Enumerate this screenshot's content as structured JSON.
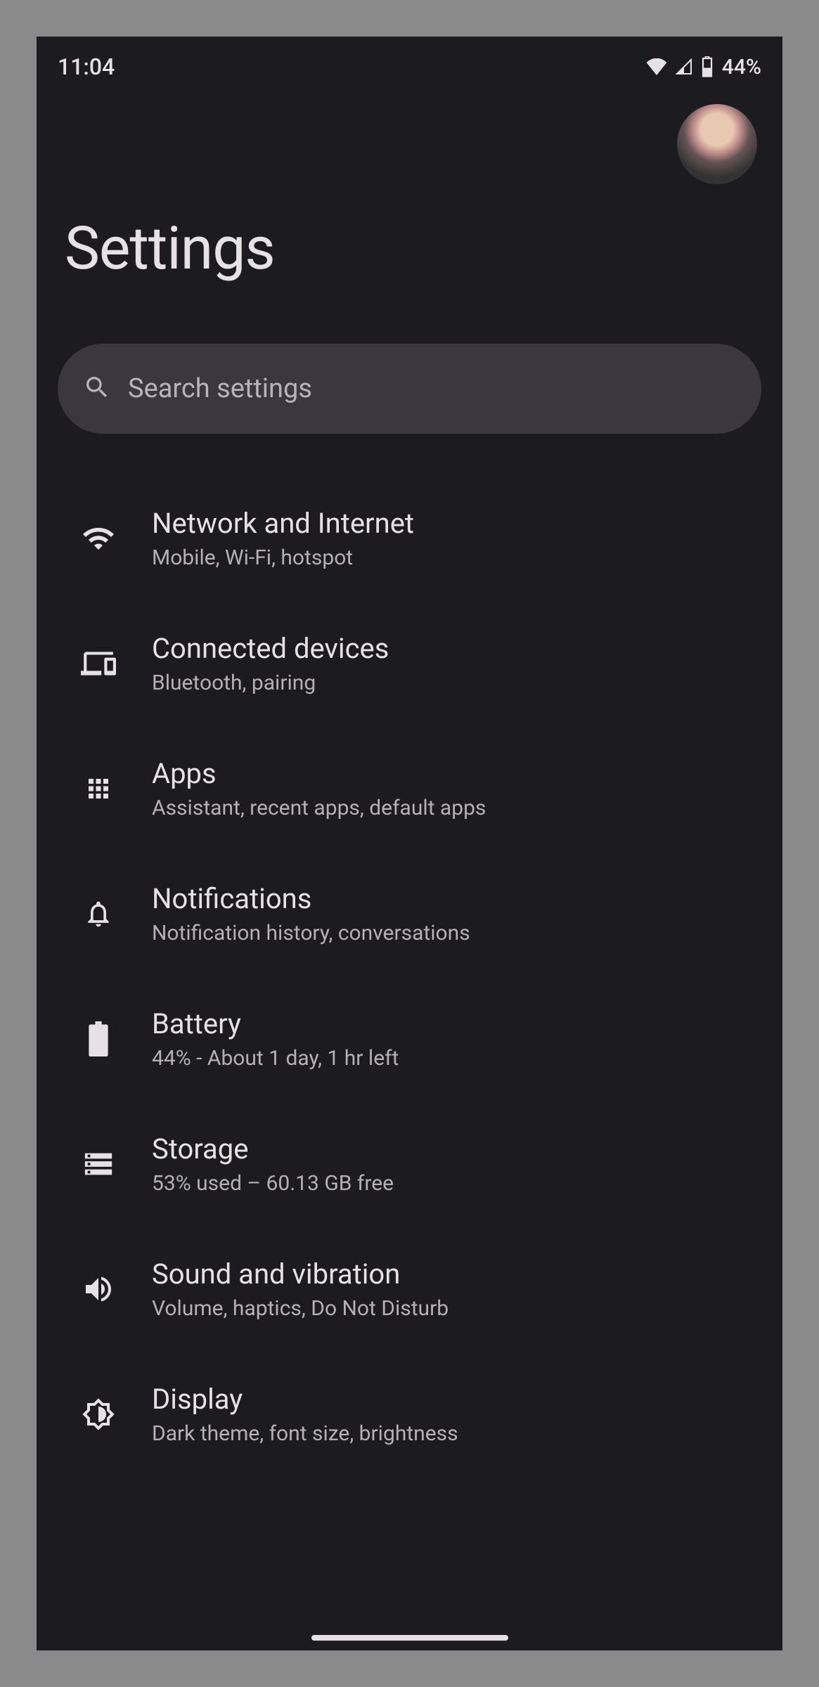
{
  "status": {
    "time": "11:04",
    "battery_pct": "44%"
  },
  "header": {
    "title": "Settings"
  },
  "search": {
    "placeholder": "Search settings"
  },
  "items": [
    {
      "icon": "wifi",
      "title": "Network and Internet",
      "sub": "Mobile, Wi-Fi, hotspot"
    },
    {
      "icon": "devices",
      "title": "Connected devices",
      "sub": "Bluetooth, pairing"
    },
    {
      "icon": "apps",
      "title": "Apps",
      "sub": "Assistant, recent apps, default apps"
    },
    {
      "icon": "bell",
      "title": "Notifications",
      "sub": "Notification history, conversations"
    },
    {
      "icon": "battery",
      "title": "Battery",
      "sub": "44% - About 1 day, 1 hr left"
    },
    {
      "icon": "storage",
      "title": "Storage",
      "sub": "53% used – 60.13 GB free"
    },
    {
      "icon": "volume",
      "title": "Sound and vibration",
      "sub": "Volume, haptics, Do Not Disturb"
    },
    {
      "icon": "display",
      "title": "Display",
      "sub": "Dark theme, font size, brightness"
    }
  ]
}
